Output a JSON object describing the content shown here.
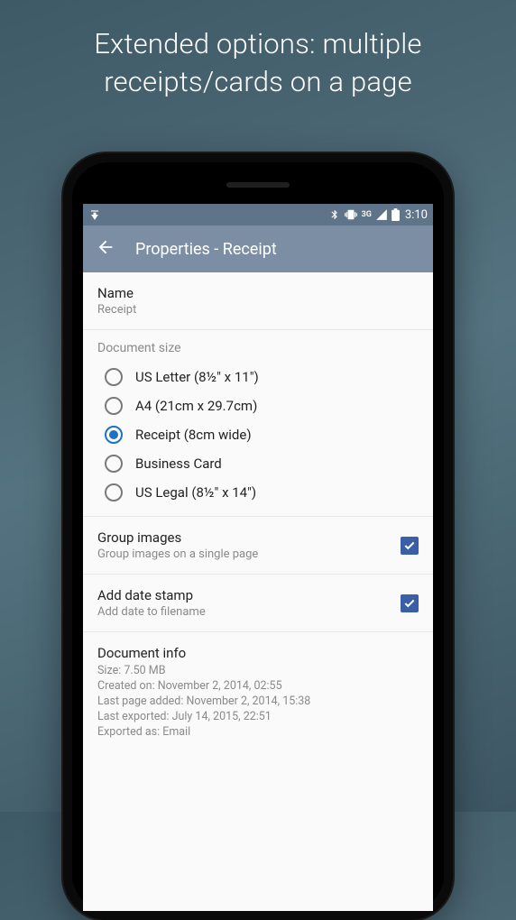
{
  "promo": {
    "line1": "Extended options: multiple",
    "line2": "receipts/cards on a page"
  },
  "status": {
    "clock": "3:10",
    "network_label": "3G"
  },
  "appbar": {
    "title": "Properties - Receipt"
  },
  "name_section": {
    "label": "Name",
    "value": "Receipt"
  },
  "size_section": {
    "header": "Document size",
    "options": [
      {
        "label": "US Letter (8½\" x 11\")",
        "selected": false
      },
      {
        "label": "A4 (21cm x 29.7cm)",
        "selected": false
      },
      {
        "label": "Receipt (8cm wide)",
        "selected": true
      },
      {
        "label": "Business Card",
        "selected": false
      },
      {
        "label": "US Legal (8½\" x 14\")",
        "selected": false
      }
    ]
  },
  "group_images": {
    "title": "Group images",
    "subtitle": "Group images on a single page",
    "checked": true
  },
  "date_stamp": {
    "title": "Add date stamp",
    "subtitle": "Add date to filename",
    "checked": true
  },
  "doc_info": {
    "header": "Document info",
    "lines": [
      "Size: 7.50 MB",
      "Created on: November 2, 2014, 02:55",
      "Last page added: November 2, 2014, 15:38",
      "Last exported: July 14, 2015, 22:51",
      "Exported as: Email"
    ]
  }
}
